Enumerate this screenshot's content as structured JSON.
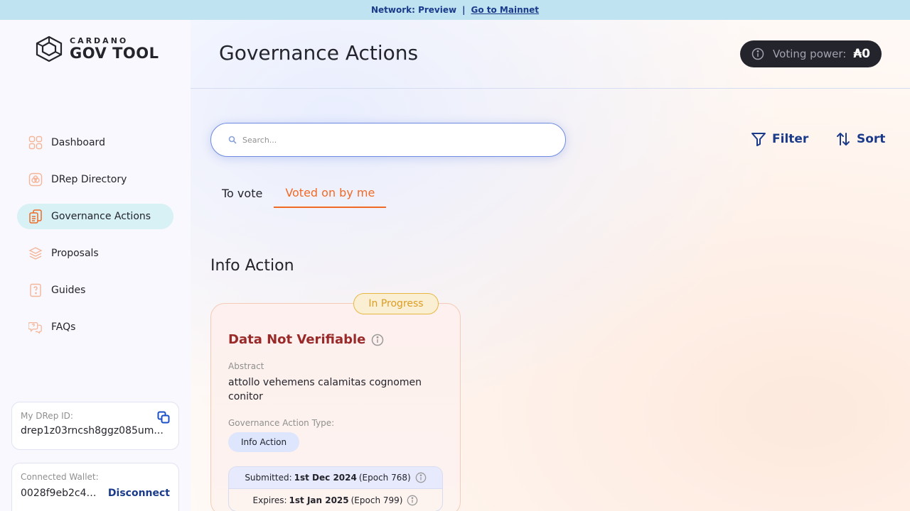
{
  "banner": {
    "network": "Network: Preview",
    "separator": "|",
    "link": "Go to Mainnet"
  },
  "logo": {
    "small": "CARDANO",
    "big": "GOV TOOL"
  },
  "sidebar": {
    "items": [
      {
        "label": "Dashboard",
        "icon": "dashboard-icon"
      },
      {
        "label": "DRep Directory",
        "icon": "drep-directory-icon"
      },
      {
        "label": "Governance Actions",
        "icon": "governance-actions-icon"
      },
      {
        "label": "Proposals",
        "icon": "proposals-icon"
      },
      {
        "label": "Guides",
        "icon": "guides-icon"
      },
      {
        "label": "FAQs",
        "icon": "faqs-icon"
      }
    ],
    "active_item": "Governance Actions",
    "drep": {
      "label": "My DRep ID:",
      "value": "drep1z03rncsh8ggz085um..."
    },
    "wallet": {
      "label": "Connected Wallet:",
      "address": "0028f9eb2c41...",
      "disconnect": "Disconnect"
    }
  },
  "header": {
    "title": "Governance Actions",
    "voting_label": "Voting power:",
    "voting_value": "₳0"
  },
  "search": {
    "placeholder": "Search..."
  },
  "toolbar": {
    "filter": "Filter",
    "sort": "Sort"
  },
  "tabs": [
    {
      "label": "To vote"
    },
    {
      "label": "Voted on by me"
    }
  ],
  "active_tab": "Voted on by me",
  "section": {
    "title": "Info Action"
  },
  "card": {
    "status": "In Progress",
    "title": "Data Not Verifiable",
    "abstract_label": "Abstract",
    "abstract": "attollo vehemens calamitas cognomen conitor",
    "type_label": "Governance Action Type:",
    "type": "Info Action",
    "submitted_prefix": "Submitted:",
    "submitted_date": "1st Dec 2024",
    "submitted_epoch": "(Epoch 768)",
    "expires_prefix": "Expires:",
    "expires_date": "1st Jan 2025",
    "expires_epoch": "(Epoch 799)"
  },
  "colors": {
    "accent_orange": "#f06a26",
    "primary_blue": "#1a3a8a",
    "banner": "#bfe3f1",
    "status_warning": "#dd9c22",
    "title_red": "#9a2a2a"
  }
}
